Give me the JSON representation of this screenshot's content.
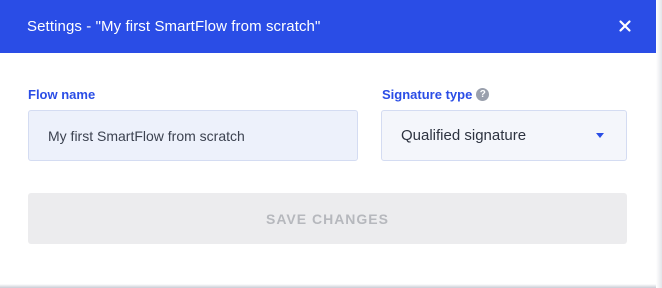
{
  "dialog": {
    "title": "Settings - \"My first SmartFlow from scratch\"",
    "close_icon": "close-icon"
  },
  "form": {
    "flow_name": {
      "label": "Flow name",
      "value": "My first SmartFlow from scratch"
    },
    "signature_type": {
      "label": "Signature type",
      "help_icon": "help-icon",
      "help_glyph": "?",
      "selected": "Qualified signature"
    },
    "save_label": "SAVE CHANGES"
  },
  "colors": {
    "accent": "#2a4de6",
    "input_bg": "#edf1fb",
    "disabled_button_bg": "#ececee",
    "disabled_button_text": "#b6b8bd"
  }
}
